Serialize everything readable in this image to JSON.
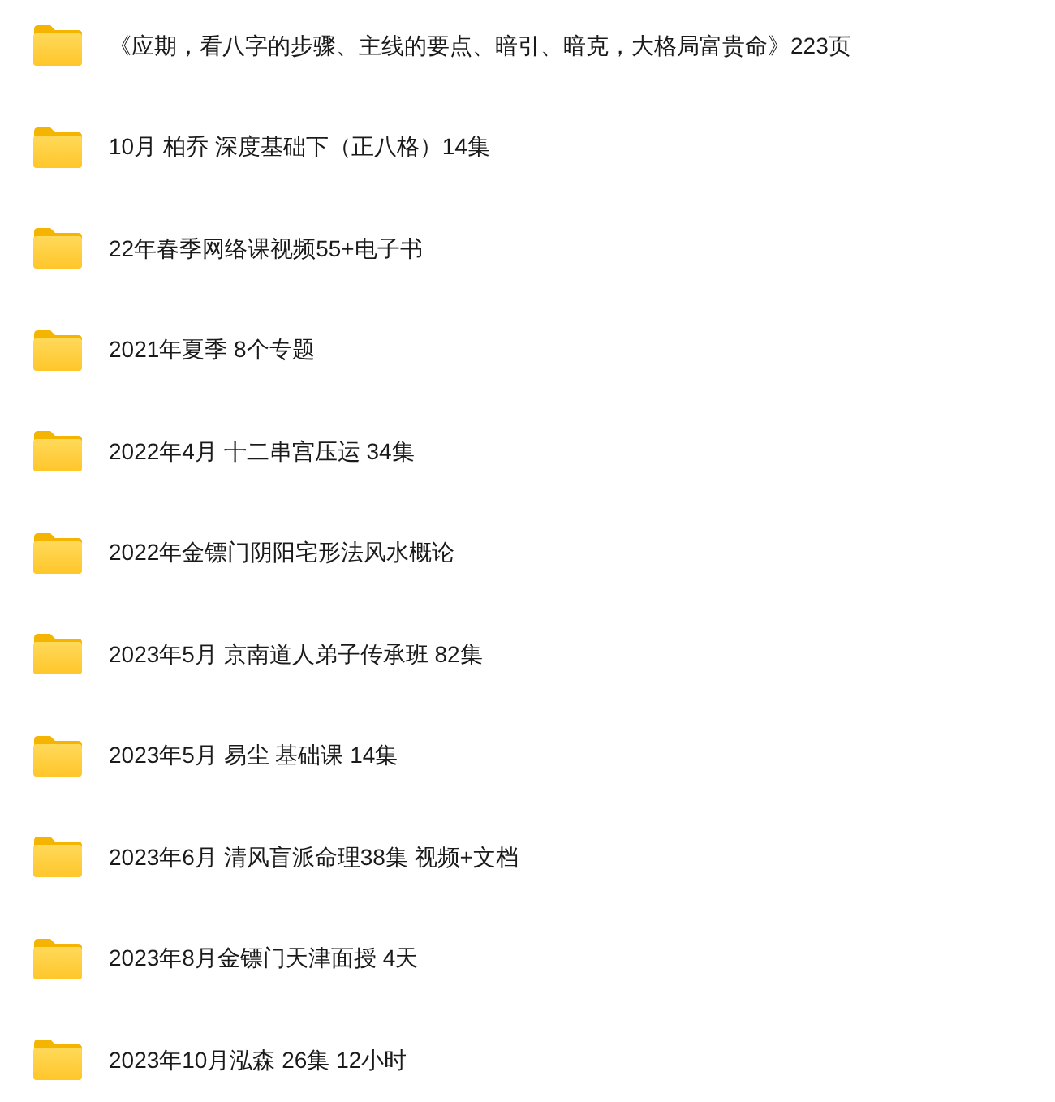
{
  "folders": [
    {
      "name": "《应期，看八字的步骤、主线的要点、暗引、暗克，大格局富贵命》223页"
    },
    {
      "name": "10月 柏乔 深度基础下（正八格）14集"
    },
    {
      "name": "22年春季网络课视频55+电子书"
    },
    {
      "name": "2021年夏季 8个专题"
    },
    {
      "name": "2022年4月 十二串宫压运 34集"
    },
    {
      "name": "2022年金镖门阴阳宅形法风水概论"
    },
    {
      "name": "2023年5月 京南道人弟子传承班 82集"
    },
    {
      "name": "2023年5月 易尘 基础课 14集"
    },
    {
      "name": "2023年6月 清风盲派命理38集 视频+文档"
    },
    {
      "name": "2023年8月金镖门天津面授 4天"
    },
    {
      "name": "2023年10月泓森 26集 12小时"
    }
  ]
}
